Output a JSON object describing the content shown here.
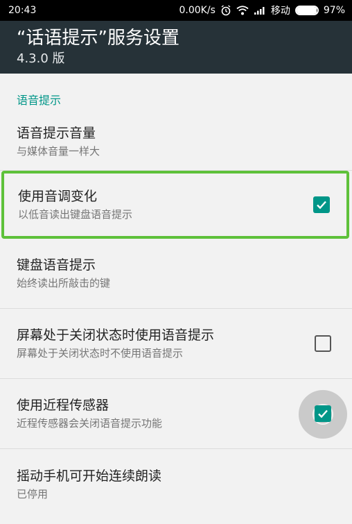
{
  "status_bar": {
    "time": "20:43",
    "speed": "0.00K/s",
    "carrier": "移动",
    "battery": "97%",
    "battery_level": 0.97,
    "icons": [
      "alarm-icon",
      "wifi-icon",
      "signal-icon",
      "battery-icon"
    ]
  },
  "app_bar": {
    "title": "“话语提示”服务设置",
    "subtitle": "4.3.0 版"
  },
  "category": {
    "label": "语音提示"
  },
  "prefs": [
    {
      "title": "语音提示音量",
      "summary": "与媒体音量一样大"
    },
    {
      "title": "使用音调变化",
      "summary": "以低音读出键盘语音提示",
      "checked": true
    },
    {
      "title": "键盘语音提示",
      "summary": "始终读出所敲击的键"
    },
    {
      "title": "屏幕处于关闭状态时使用语音提示",
      "summary": "屏幕处于关闭状态时不使用语音提示",
      "checked": false
    },
    {
      "title": "使用近程传感器",
      "summary": "近程传感器会关闭语音提示功能",
      "checked": true
    },
    {
      "title": "摇动手机可开始连续朗读",
      "summary": "已停用"
    }
  ],
  "colors": {
    "accent": "#009688",
    "app_bar": "#263238",
    "highlight": "#5ec13a"
  }
}
